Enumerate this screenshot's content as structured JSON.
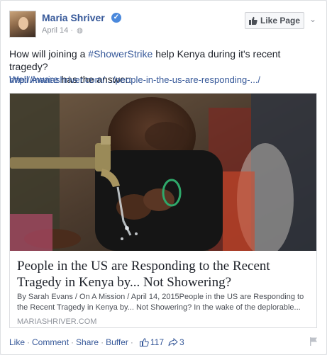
{
  "header": {
    "page_name": "Maria Shriver",
    "date": "April 14 ·",
    "like_page_label": "Like Page"
  },
  "post": {
    "line1_pre": "How will joining a ",
    "hashtag": "#ShowerStrike",
    "line1_post": " help Kenya during it's recent tragedy?",
    "mention": "Well Aware",
    "line2_post": " has the answer:",
    "url": "http://mariashriver.com/.../people-in-the-us-are-responding-.../"
  },
  "attachment": {
    "title": "People in the US are Responding to the Recent Tragedy in Kenya by... Not Showering?",
    "description": "By Sarah Evans / On A Mission / April 14, 2015People in the US are Responding to the Recent Tragedy in Kenya by... Not Showering? In the wake of the deplorable...",
    "source": "MARIASHRIVER.COM"
  },
  "footer": {
    "like": "Like",
    "comment": "Comment",
    "share": "Share",
    "buffer": "Buffer",
    "like_count": "117",
    "share_count": "3"
  },
  "colors": {
    "link": "#365899",
    "meta": "#90949c"
  }
}
